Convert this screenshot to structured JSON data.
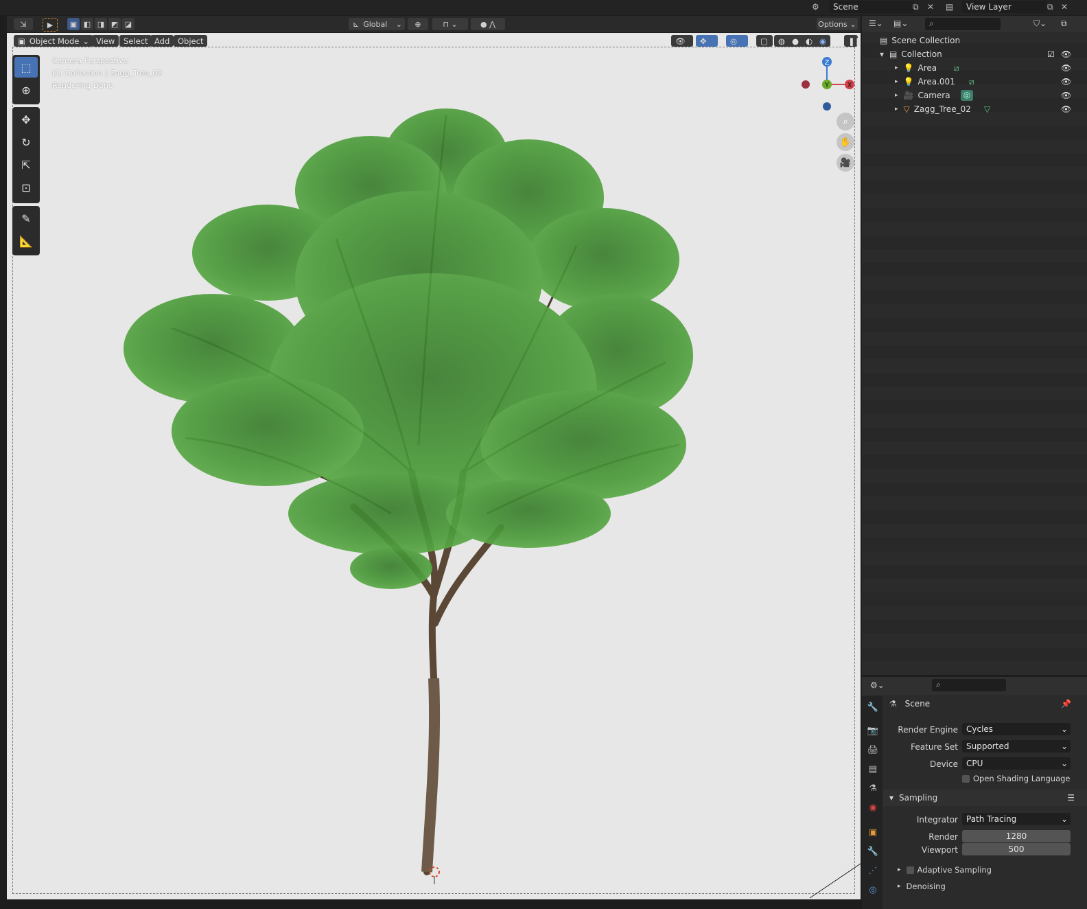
{
  "top_bar": {
    "scene_label": "Scene",
    "view_layer_label": "View Layer"
  },
  "tool_header": {
    "orientation": "Global",
    "options": "Options"
  },
  "viewport": {
    "mode": "Object Mode",
    "menu": [
      "View",
      "Select",
      "Add",
      "Object"
    ],
    "info": {
      "line1": "Camera Perspective",
      "line2": "(1) Collection | Zagg_Tree_02",
      "line3": "Rendering Done"
    },
    "gizmo": {
      "z": "Z",
      "y": "Y",
      "x": "X"
    }
  },
  "outliner": {
    "root": "Scene Collection",
    "collection": "Collection",
    "items": [
      {
        "name": "Area"
      },
      {
        "name": "Area.001"
      },
      {
        "name": "Camera"
      },
      {
        "name": "Zagg_Tree_02"
      }
    ]
  },
  "properties": {
    "context": "Scene",
    "render_engine_label": "Render Engine",
    "render_engine": "Cycles",
    "feature_set_label": "Feature Set",
    "feature_set": "Supported",
    "device_label": "Device",
    "device": "CPU",
    "osl_label": "Open Shading Language",
    "sampling_title": "Sampling",
    "integrator_label": "Integrator",
    "integrator": "Path Tracing",
    "render_label": "Render",
    "render_samples": "1280",
    "viewport_label": "Viewport",
    "viewport_samples": "500",
    "adaptive_label": "Adaptive Sampling",
    "denoising_label": "Denoising"
  },
  "colors": {
    "accent": "#4772b3",
    "viewport_bg": "#e7e7e7",
    "leaf": "#3f8a32",
    "trunk": "#5b4736"
  }
}
